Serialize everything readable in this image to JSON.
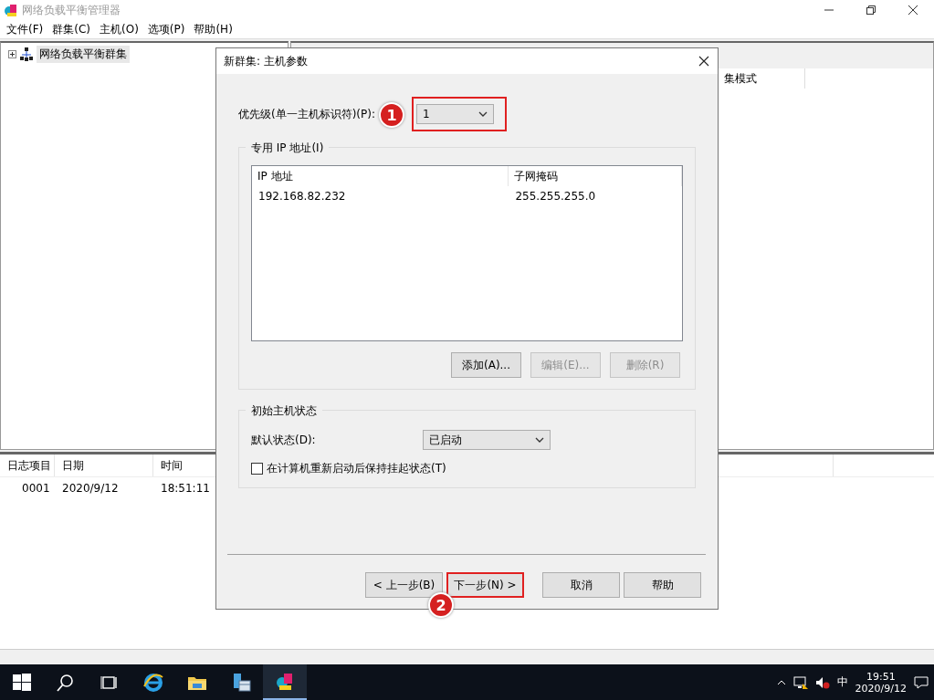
{
  "window": {
    "title": "网络负载平衡管理器"
  },
  "menu": [
    {
      "label": "文件(F)"
    },
    {
      "label": "群集(C)"
    },
    {
      "label": "主机(O)"
    },
    {
      "label": "选项(P)"
    },
    {
      "label": "帮助(H)"
    }
  ],
  "tree": [
    {
      "label": "网络负载平衡群集",
      "expanded": false
    }
  ],
  "cluster_table": {
    "columns": [
      "集模式"
    ]
  },
  "log_table": {
    "columns": [
      "日志项目",
      "日期",
      "时间"
    ],
    "rows": [
      [
        "0001",
        "2020/9/12",
        "18:51:11"
      ]
    ]
  },
  "dialog": {
    "title": "新群集: 主机参数",
    "priority": {
      "label": "优先级(单一主机标识符)(P):",
      "value": "1",
      "highlighted": true,
      "callout": "1"
    },
    "dedicated_ip": {
      "legend": "专用 IP 地址(I)",
      "columns": [
        "IP 地址",
        "子网掩码"
      ],
      "rows": [
        [
          "192.168.82.232",
          "255.255.255.0"
        ]
      ],
      "buttons": [
        {
          "label": "添加(A)...",
          "disabled": false
        },
        {
          "label": "编辑(E)...",
          "disabled": true
        },
        {
          "label": "删除(R)",
          "disabled": true
        }
      ]
    },
    "initial_state": {
      "legend": "初始主机状态",
      "default_state": {
        "label": "默认状态(D):",
        "value": "已启动"
      },
      "suspend_checkbox": {
        "label": "在计算机重新启动后保持挂起状态(T)",
        "checked": false
      }
    },
    "buttons": [
      {
        "label": "< 上一步(B)",
        "highlighted": false
      },
      {
        "label": "下一步(N) >",
        "highlighted": true,
        "callout": "2"
      },
      {
        "label": "取消",
        "highlighted": false
      },
      {
        "label": "帮助",
        "highlighted": false
      }
    ]
  },
  "taskbar": {
    "apps": [
      {
        "kind": "ie",
        "active": false
      },
      {
        "kind": "folder",
        "active": false
      },
      {
        "kind": "server",
        "active": false
      },
      {
        "kind": "nlb",
        "active": true
      }
    ],
    "ime": "中",
    "time": "19:51",
    "date": "2020/9/12"
  }
}
